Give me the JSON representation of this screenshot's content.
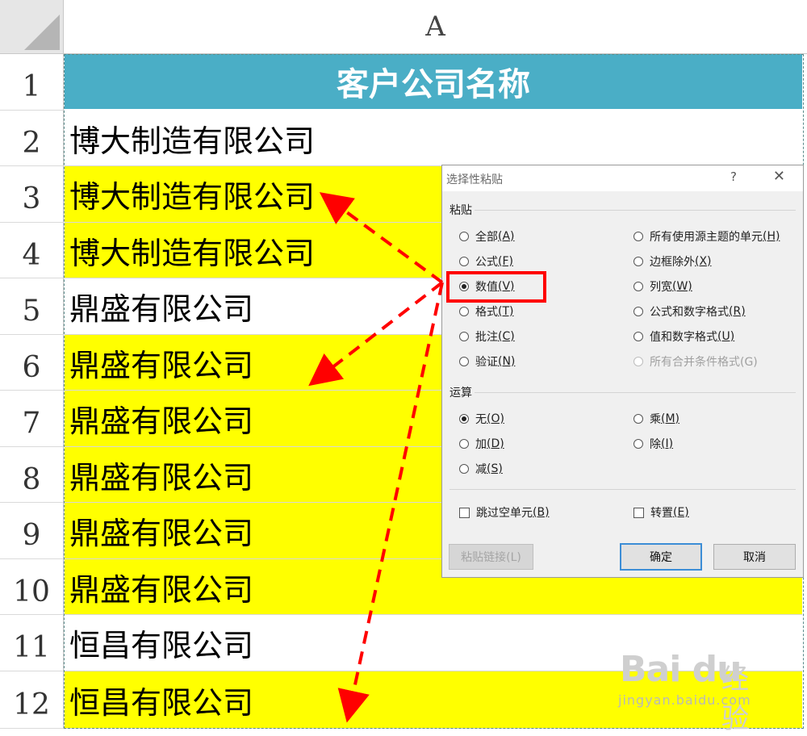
{
  "sheet": {
    "column_header": "A",
    "rows": [
      {
        "num": "1",
        "text": "客户公司名称",
        "style": "header"
      },
      {
        "num": "2",
        "text": "博大制造有限公司",
        "style": "white"
      },
      {
        "num": "3",
        "text": "博大制造有限公司",
        "style": "yellow"
      },
      {
        "num": "4",
        "text": "博大制造有限公司",
        "style": "yellow"
      },
      {
        "num": "5",
        "text": "鼎盛有限公司",
        "style": "white"
      },
      {
        "num": "6",
        "text": "鼎盛有限公司",
        "style": "yellow"
      },
      {
        "num": "7",
        "text": "鼎盛有限公司",
        "style": "yellow"
      },
      {
        "num": "8",
        "text": "鼎盛有限公司",
        "style": "yellow"
      },
      {
        "num": "9",
        "text": "鼎盛有限公司",
        "style": "yellow"
      },
      {
        "num": "10",
        "text": "鼎盛有限公司",
        "style": "yellow"
      },
      {
        "num": "11",
        "text": "恒昌有限公司",
        "style": "white"
      },
      {
        "num": "12",
        "text": "恒昌有限公司",
        "style": "yellow"
      }
    ],
    "colors": {
      "header_fill": "#4aaec6",
      "highlight_fill": "#ffff00"
    }
  },
  "dialog": {
    "title": "选择性粘贴",
    "help": "?",
    "close": "✕",
    "paste_group": "粘贴",
    "paste_options_left": [
      {
        "label": "全部",
        "key": "(A)",
        "selected": false
      },
      {
        "label": "公式",
        "key": "(F)",
        "selected": false
      },
      {
        "label": "数值",
        "key": "(V)",
        "selected": true
      },
      {
        "label": "格式",
        "key": "(T)",
        "selected": false
      },
      {
        "label": "批注",
        "key": "(C)",
        "selected": false
      },
      {
        "label": "验证",
        "key": "(N)",
        "selected": false
      }
    ],
    "paste_options_right": [
      {
        "label": "所有使用源主题的单元",
        "key": "(H)",
        "disabled": false
      },
      {
        "label": "边框除外",
        "key": "(X)",
        "disabled": false
      },
      {
        "label": "列宽",
        "key": "(W)",
        "disabled": false
      },
      {
        "label": "公式和数字格式",
        "key": "(R)",
        "disabled": false
      },
      {
        "label": "值和数字格式",
        "key": "(U)",
        "disabled": false
      },
      {
        "label": "所有合并条件格式(G)",
        "key": "",
        "disabled": true
      }
    ],
    "operation_group": "运算",
    "operation_left": [
      {
        "label": "无",
        "key": "(O)",
        "selected": true
      },
      {
        "label": "加",
        "key": "(D)",
        "selected": false
      },
      {
        "label": "减",
        "key": "(S)",
        "selected": false
      }
    ],
    "operation_right": [
      {
        "label": "乘",
        "key": "(M)",
        "selected": false
      },
      {
        "label": "除",
        "key": "(I)",
        "selected": false
      }
    ],
    "skip_blanks": {
      "label": "跳过空单元",
      "key": "(B)"
    },
    "transpose": {
      "label": "转置",
      "key": "(E)"
    },
    "paste_link": "粘贴链接(L)",
    "ok": "确定",
    "cancel": "取消"
  },
  "annotation": {
    "box_color": "#ff0000",
    "arrow_color": "#ff0000"
  },
  "watermark": {
    "logo": "Bai du",
    "brand": "经验",
    "url": "jingyan.baidu.com"
  }
}
